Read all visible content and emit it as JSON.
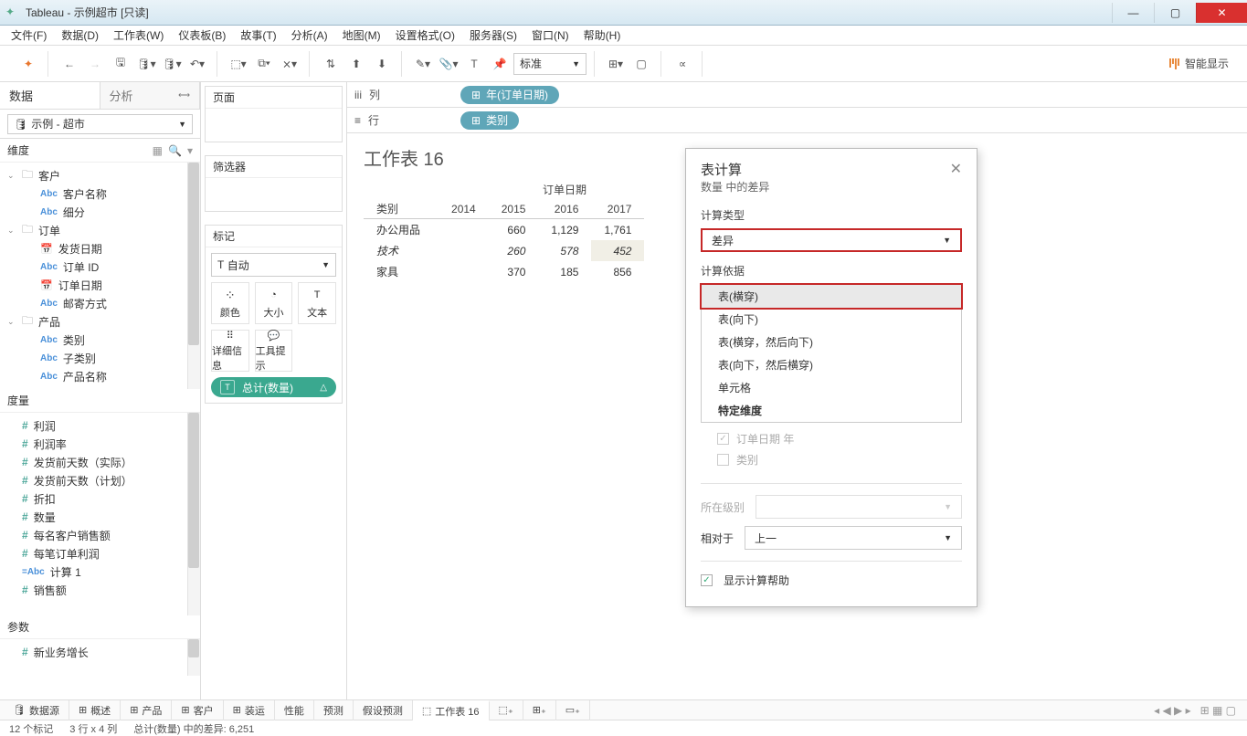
{
  "titlebar": {
    "app": "Tableau",
    "doc": "示例超市",
    "readonly": "[只读]"
  },
  "menu": {
    "file": "文件(F)",
    "data": "数据(D)",
    "ws": "工作表(W)",
    "dash": "仪表板(B)",
    "story": "故事(T)",
    "analysis": "分析(A)",
    "map": "地图(M)",
    "format": "设置格式(O)",
    "server": "服务器(S)",
    "window": "窗口(N)",
    "help": "帮助(H)"
  },
  "toolbar": {
    "fit": "标准",
    "smart": "智能显示"
  },
  "side": {
    "tab_data": "数据",
    "tab_analysis": "分析",
    "datasource": "示例 - 超市",
    "dim_hdr": "维度",
    "meas_hdr": "度量",
    "param_hdr": "参数",
    "dim_groups": [
      {
        "name": "客户",
        "items": [
          {
            "t": "abc",
            "n": "客户名称"
          },
          {
            "t": "abc",
            "n": "细分"
          }
        ]
      },
      {
        "name": "订单",
        "items": [
          {
            "t": "date",
            "n": "发货日期"
          },
          {
            "t": "abc",
            "n": "订单 ID"
          },
          {
            "t": "date",
            "n": "订单日期"
          },
          {
            "t": "abc",
            "n": "邮寄方式"
          }
        ]
      },
      {
        "name": "产品",
        "items": [
          {
            "t": "abc",
            "n": "类别"
          },
          {
            "t": "abc",
            "n": "子类别"
          },
          {
            "t": "abc",
            "n": "产品名称"
          }
        ]
      }
    ],
    "measures": [
      "利润",
      "利润率",
      "发货前天数（实际）",
      "发货前天数（计划）",
      "折扣",
      "数量",
      "每名客户销售额",
      "每笔订单利润",
      "计算 1",
      "销售额"
    ],
    "measure_calc_prefix": "=Abc",
    "params": [
      "新业务增长"
    ]
  },
  "mid": {
    "pages": "页面",
    "filters": "筛选器",
    "marks": "标记",
    "mark_type": "自动",
    "cells": {
      "color": "颜色",
      "size": "大小",
      "text": "文本",
      "detail": "详细信息",
      "tooltip": "工具提示"
    },
    "pill_prefix": "T",
    "pill": "总计(数量)",
    "pill_tri": "△"
  },
  "shelves": {
    "cols_lbl": "列",
    "cols_icon": "iii",
    "cols_pill": "年(订单日期)",
    "rows_lbl": "行",
    "rows_pill": "类别"
  },
  "ws": {
    "title": "工作表 16",
    "colgroup": "订单日期",
    "row_hdr": "类别",
    "years": [
      "2014",
      "2015",
      "2016",
      "2017"
    ],
    "rows": [
      {
        "lbl": "办公用品",
        "v": [
          "",
          "660",
          "1,129",
          "1,761"
        ]
      },
      {
        "lbl": "技术",
        "v": [
          "",
          "260",
          "578",
          "452"
        ],
        "last_ital": true
      },
      {
        "lbl": "家具",
        "v": [
          "",
          "370",
          "185",
          "856"
        ]
      }
    ]
  },
  "dialog": {
    "title": "表计算",
    "sub": "数量 中的差异",
    "calc_type_lbl": "计算类型",
    "calc_type": "差异",
    "compute_lbl": "计算依据",
    "compute_opts": [
      "表(横穿)",
      "表(向下)",
      "表(横穿，然后向下)",
      "表(向下，然后横穿)",
      "单元格",
      "特定维度"
    ],
    "dim1": "订单日期 年",
    "dim2": "类别",
    "level_lbl": "所在级别",
    "rel_lbl": "相对于",
    "rel_val": "上一",
    "help": "显示计算帮助"
  },
  "tabs": {
    "ds": "数据源",
    "items": [
      "概述",
      "产品",
      "客户",
      "装运",
      "性能",
      "预测",
      "假设预测",
      "工作表 16"
    ],
    "active": 7
  },
  "status": {
    "a": "12 个标记",
    "b": "3 行 x 4 列",
    "c": "总计(数量) 中的差异: 6,251"
  }
}
